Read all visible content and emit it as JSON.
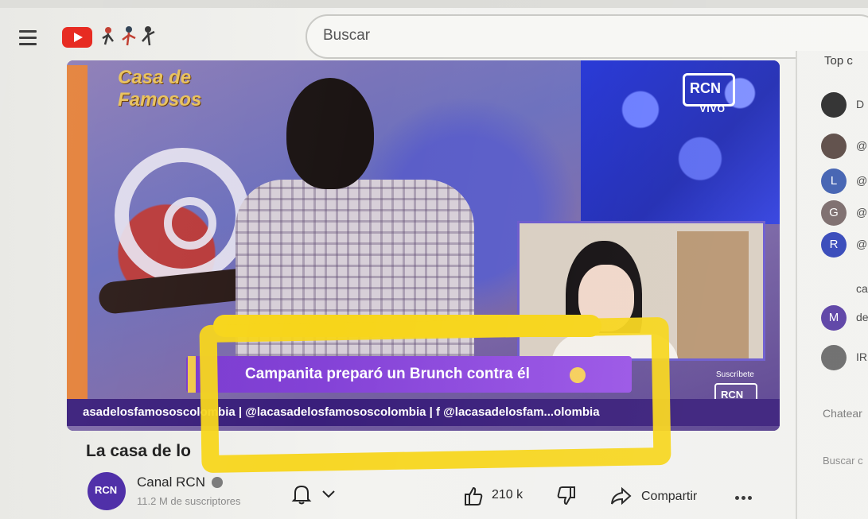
{
  "header": {
    "search_placeholder": "Buscar"
  },
  "player": {
    "live_badge": "VIVO",
    "show_logo_text": "Casa de Famosos",
    "lower_third_caption": "Campanita preparó un Brunch contra él",
    "ticker_text": "asadelosfamososcolombia  |  @lacasadelosfamososcolombia  |  f  @lacasadelosfam...olombia",
    "subscribe_text": "Suscríbete"
  },
  "video": {
    "title": "La casa de lo"
  },
  "channel": {
    "name": "Canal RCN",
    "subscribers": "11.2 M de suscriptores"
  },
  "actions": {
    "like_count": "210 k",
    "share_label": "Compartir"
  },
  "chat": {
    "header": "Top c",
    "items": [
      {
        "avatar_letter": "",
        "snippet": "D",
        "color": "#2b2b2b"
      },
      {
        "avatar_letter": "",
        "snippet": "@",
        "color": "#5b4a45"
      },
      {
        "avatar_letter": "L",
        "snippet": "@",
        "color": "#3f5fb0"
      },
      {
        "avatar_letter": "G",
        "snippet": "@",
        "color": "#7a6a6a"
      },
      {
        "avatar_letter": "R",
        "snippet": "@",
        "color": "#3346b8"
      },
      {
        "avatar_letter": "",
        "snippet": "ca",
        "color": "transparent"
      },
      {
        "avatar_letter": "M",
        "snippet": "de",
        "color": "#5a3fa4"
      },
      {
        "avatar_letter": "",
        "snippet": "IRF",
        "color": "#6b6b6b"
      }
    ],
    "input_placeholder": "Chatear",
    "search_placeholder": "Buscar c"
  }
}
